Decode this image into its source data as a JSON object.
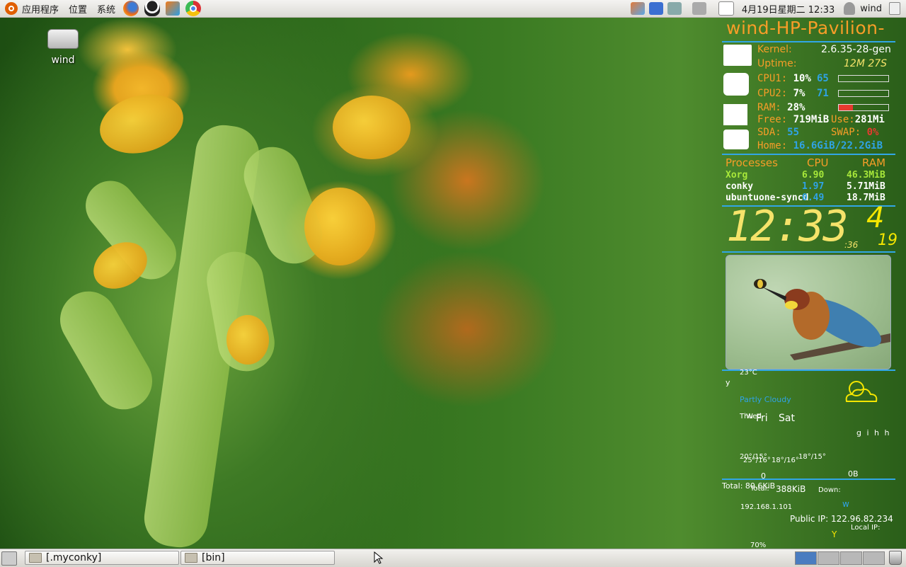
{
  "top_panel": {
    "menus": [
      "应用程序",
      "位置",
      "系统"
    ],
    "launchers": [
      "firefox-icon",
      "qq-icon",
      "fetion-icon",
      "chrome-icon"
    ],
    "clock": "4月19日星期二 12:33",
    "user": "wind"
  },
  "desktop": {
    "home_icon_label": "wind"
  },
  "conky": {
    "hostname": "wind-HP-Pavilion-",
    "kernel_label": "Kernel:",
    "kernel": "2.6.35-28-gen",
    "uptime_label": "Uptime:",
    "uptime": "12M 27S",
    "cpu1_label": "CPU1:",
    "cpu1": "10%",
    "cpu1_freq": "65",
    "cpu2_label": "CPU2:",
    "cpu2": "7%",
    "cpu2_freq": "71",
    "ram_label": "RAM:",
    "ram": "28%",
    "ram_fraction": 0.28,
    "free_label": "Free:",
    "free": "719MiB",
    "use_label": "Use:",
    "use": "281Mi",
    "sda_label": "SDA:",
    "sda": "55",
    "swap_label": "SWAP:",
    "swap": "0%",
    "home_label": "Home:",
    "home": "16.6GiB/22.2GiB",
    "proc_header": {
      "name": "Processes",
      "cpu": "CPU",
      "ram": "RAM"
    },
    "processes": [
      {
        "name": "Xorg",
        "cpu": "6.90",
        "ram": "46.3MiB"
      },
      {
        "name": "conky",
        "cpu": "1.97",
        "ram": "5.71MiB"
      },
      {
        "name": "ubuntuone-syncd",
        "cpu": "0.49",
        "ram": "18.7MiB"
      }
    ],
    "time": "12:33",
    "seconds": ":36",
    "weekday_num": "4",
    "day": "19",
    "weather": {
      "temp": "23°C",
      "y": "y",
      "condition": "Partly Cloudy",
      "day_label_1": "Thu",
      "day_label_2": "Wed",
      "day_fri": "Fri",
      "day_sat": "Sat",
      "icons_text": "g i h h",
      "range_1": "20°/15°",
      "range_2": "25°/16°",
      "range_3": "18°/16°",
      "range_4": "18°/15°"
    },
    "net": {
      "zero": "0",
      "ob": "0B",
      "total": "Total: 80.6KiB",
      "total_up": "Total:",
      "up": "388KiB",
      "down": "Down:",
      "local_ip_value": "192.168.1.101",
      "w": "w",
      "public_ip": "Public IP: 122.96.82.234",
      "local_ip_label": "Local IP:",
      "y": "Y",
      "percent": "70%"
    }
  },
  "taskbar": {
    "tasks": [
      "[.myconky]",
      "[bin]"
    ]
  },
  "colors": {
    "conky_orange": "#f79d28",
    "conky_blue": "#2fa3e6",
    "clock_yellow": "#f5e36a"
  }
}
